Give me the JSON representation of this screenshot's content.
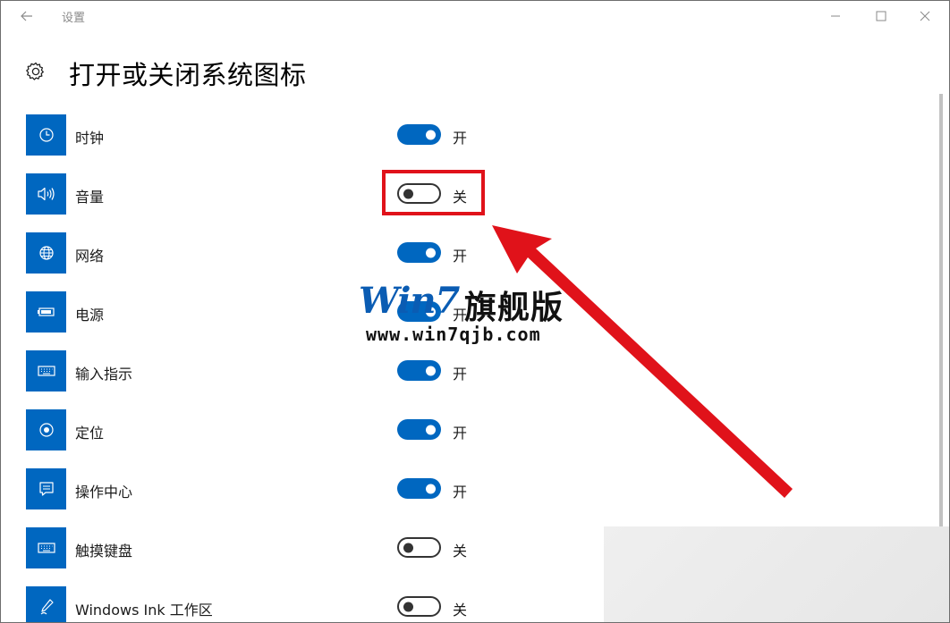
{
  "window": {
    "title": "设置"
  },
  "header": {
    "title": "打开或关闭系统图标"
  },
  "items": [
    {
      "label": "时钟",
      "state": "开",
      "on": true,
      "icon": "clock-icon"
    },
    {
      "label": "音量",
      "state": "关",
      "on": false,
      "icon": "volume-icon"
    },
    {
      "label": "网络",
      "state": "开",
      "on": true,
      "icon": "globe-icon"
    },
    {
      "label": "电源",
      "state": "开",
      "on": true,
      "icon": "battery-icon"
    },
    {
      "label": "输入指示",
      "state": "开",
      "on": true,
      "icon": "keyboard-icon"
    },
    {
      "label": "定位",
      "state": "开",
      "on": true,
      "icon": "location-icon"
    },
    {
      "label": "操作中心",
      "state": "开",
      "on": true,
      "icon": "action-center-icon"
    },
    {
      "label": "触摸键盘",
      "state": "关",
      "on": false,
      "icon": "keyboard-icon"
    },
    {
      "label": "Windows Ink 工作区",
      "state": "关",
      "on": false,
      "icon": "pen-icon"
    }
  ],
  "watermark": {
    "logo": "Win7",
    "name": "旗舰版",
    "url": "www.win7qjb.com"
  },
  "colors": {
    "accent": "#0067c0",
    "highlight": "#e0121a"
  }
}
